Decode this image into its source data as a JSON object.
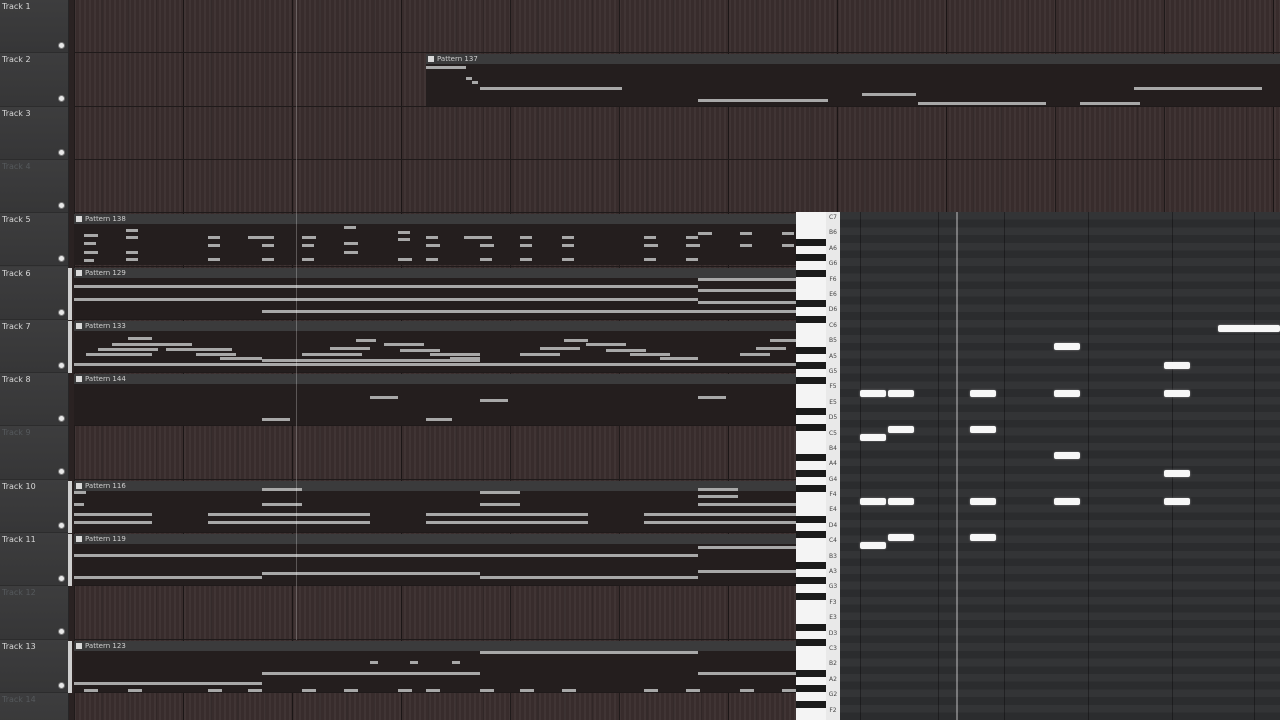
{
  "tracks": [
    {
      "label": "Track 1",
      "dim": false
    },
    {
      "label": "Track 2",
      "dim": false
    },
    {
      "label": "Track 3",
      "dim": false
    },
    {
      "label": "Track 4",
      "dim": true
    },
    {
      "label": "Track 5",
      "dim": false
    },
    {
      "label": "Track 6",
      "dim": false
    },
    {
      "label": "Track 7",
      "dim": false
    },
    {
      "label": "Track 8",
      "dim": false
    },
    {
      "label": "Track 9",
      "dim": true
    },
    {
      "label": "Track 10",
      "dim": false
    },
    {
      "label": "Track 11",
      "dim": false
    },
    {
      "label": "Track 12",
      "dim": true
    },
    {
      "label": "Track 13",
      "dim": false
    },
    {
      "label": "Track 14",
      "dim": true
    }
  ],
  "patterns": [
    {
      "name": "Pattern 137",
      "track": 2
    },
    {
      "name": "Pattern 138",
      "track": 5
    },
    {
      "name": "Pattern 129",
      "track": 6
    },
    {
      "name": "Pattern 133",
      "track": 7
    },
    {
      "name": "Pattern 144",
      "track": 8
    },
    {
      "name": "Pattern 116",
      "track": 10
    },
    {
      "name": "Pattern 119",
      "track": 11
    },
    {
      "name": "Pattern 123",
      "track": 13
    }
  ],
  "piano_roll": {
    "key_labels": [
      "C7",
      "B6",
      "A6",
      "G6",
      "F6",
      "E6",
      "D6",
      "C6",
      "B5",
      "A5",
      "G5",
      "F5",
      "E5",
      "D5",
      "C5",
      "B4",
      "A4",
      "G4",
      "F4",
      "E4",
      "D4",
      "C4",
      "B3",
      "A3",
      "G3",
      "F3",
      "E3",
      "D3",
      "C3",
      "B2",
      "A2",
      "G2",
      "F2"
    ]
  },
  "colors": {
    "track_bg": "#3a2e2e",
    "header_bg": "#3a3a3b",
    "note": "#f7f7f7",
    "clip_note": "#a8a8a8"
  }
}
